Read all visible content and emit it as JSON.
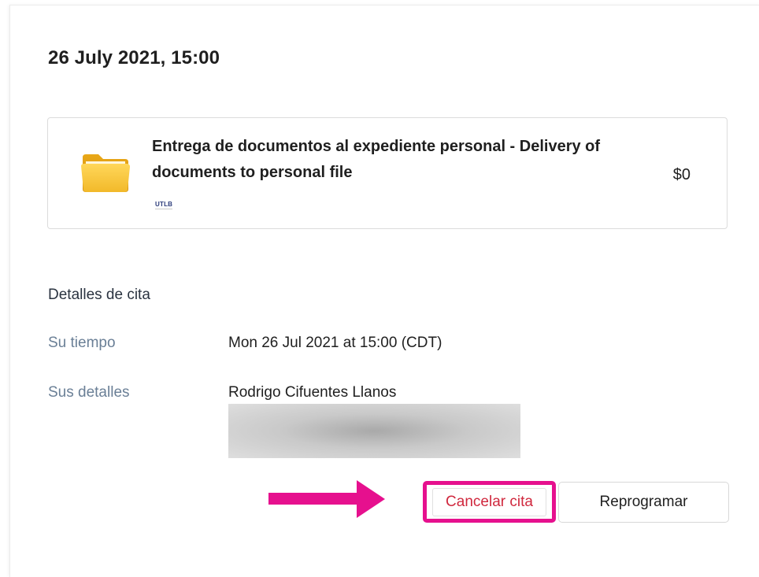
{
  "appointment": {
    "date_heading": "26 July 2021, 15:00"
  },
  "service": {
    "title": "Entrega de documentos al expediente personal - Delivery of documents to personal file",
    "price": "$0",
    "provider_logo_text": "UTLB",
    "icon": "folder-icon"
  },
  "details": {
    "heading": "Detalles de cita",
    "time_label": "Su tiempo",
    "time_value": "Mon 26 Jul 2021 at 15:00 (CDT)",
    "details_label": "Sus detalles",
    "name_value": "Rodrigo Cifuentes Llanos"
  },
  "actions": {
    "cancel_label": "Cancelar cita",
    "reschedule_label": "Reprogramar"
  },
  "colors": {
    "highlight": "#e6108e",
    "cancel_text": "#d0283e",
    "label_text": "#6a7f96"
  }
}
